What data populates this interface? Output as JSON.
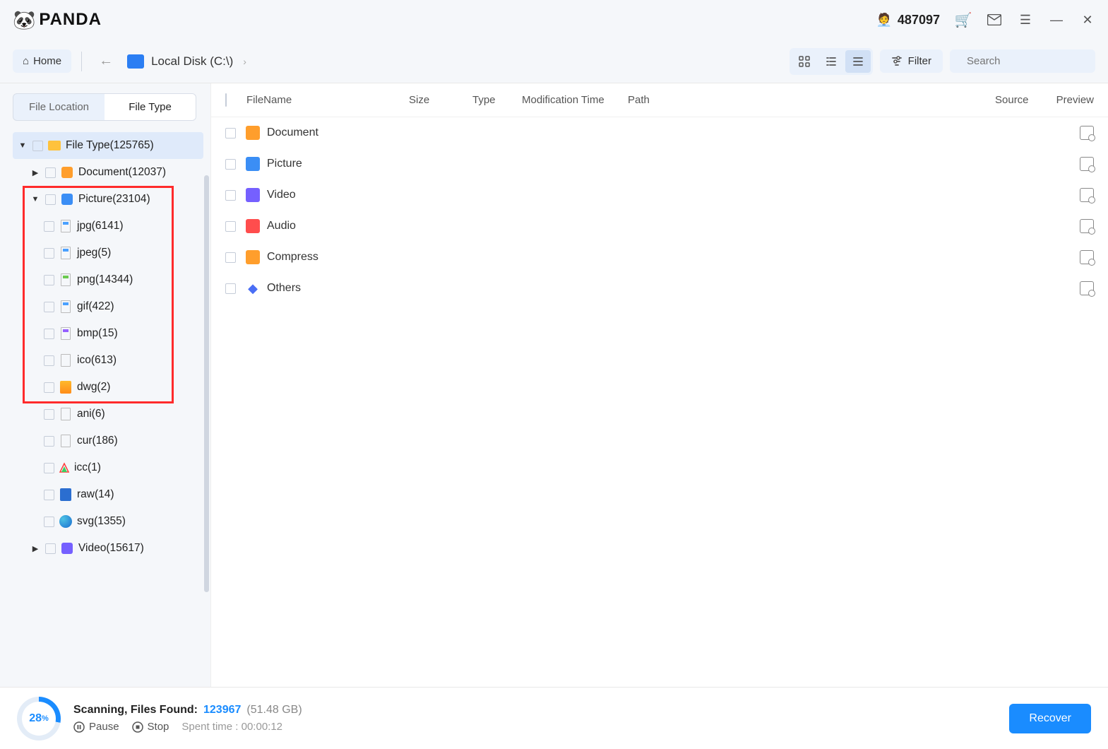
{
  "app": {
    "name": "PANDA"
  },
  "user": {
    "id": "487097"
  },
  "toolbar": {
    "home_label": "Home",
    "breadcrumb": "Local Disk (C:\\)",
    "filter_label": "Filter",
    "search_placeholder": "Search"
  },
  "sidebar": {
    "tab_location": "File Location",
    "tab_type": "File Type",
    "root": {
      "label": "File Type(125765)"
    },
    "document": {
      "label": "Document(12037)"
    },
    "picture": {
      "label": "Picture(23104)"
    },
    "pic_children": {
      "jpg": "jpg(6141)",
      "jpeg": "jpeg(5)",
      "png": "png(14344)",
      "gif": "gif(422)",
      "bmp": "bmp(15)",
      "ico": "ico(613)",
      "dwg": "dwg(2)",
      "ani": "ani(6)",
      "cur": "cur(186)",
      "icc": "icc(1)",
      "raw": "raw(14)",
      "svg": "svg(1355)"
    },
    "video": {
      "label": "Video(15617)"
    }
  },
  "columns": {
    "name": "FileName",
    "size": "Size",
    "type": "Type",
    "mod": "Modification Time",
    "path": "Path",
    "source": "Source",
    "preview": "Preview"
  },
  "categories": {
    "document": "Document",
    "picture": "Picture",
    "video": "Video",
    "audio": "Audio",
    "compress": "Compress",
    "others": "Others"
  },
  "footer": {
    "percent": "28",
    "percent_suffix": "%",
    "scanning_label": "Scanning, Files Found:",
    "count": "123967",
    "size": "(51.48 GB)",
    "pause": "Pause",
    "stop": "Stop",
    "spent_label": "Spent time :",
    "spent_value": "00:00:12",
    "recover": "Recover"
  }
}
